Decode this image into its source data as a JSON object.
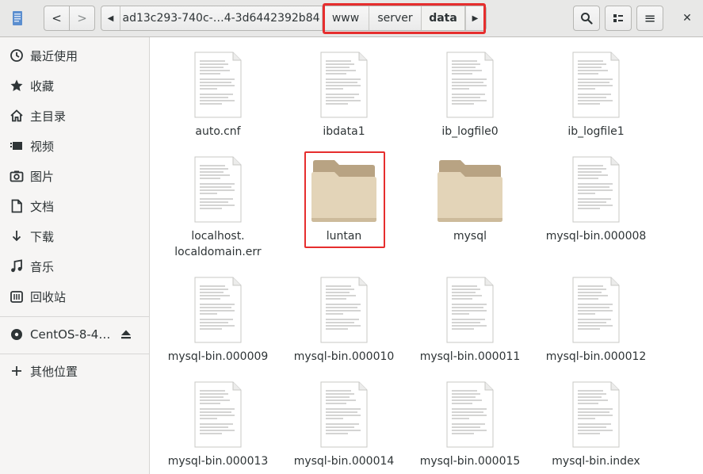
{
  "header": {
    "path_segments": [
      "ad13c293-740c-…4-3d6442392b84",
      "www",
      "server",
      "data"
    ],
    "back_glyph": "<",
    "forward_glyph": ">",
    "left_arrow_glyph": "◀",
    "right_arrow_glyph": "▶",
    "search_glyph": "🔍",
    "menu_glyph": "≡",
    "close_glyph": "✕"
  },
  "sidebar": {
    "items": [
      {
        "label": "最近使用",
        "icon": "clock-icon"
      },
      {
        "label": "收藏",
        "icon": "star-icon"
      },
      {
        "label": "主目录",
        "icon": "home-icon"
      },
      {
        "label": "视频",
        "icon": "video-icon"
      },
      {
        "label": "图片",
        "icon": "camera-icon"
      },
      {
        "label": "文档",
        "icon": "document-icon"
      },
      {
        "label": "下载",
        "icon": "download-icon"
      },
      {
        "label": "音乐",
        "icon": "music-icon"
      },
      {
        "label": "回收站",
        "icon": "trash-icon"
      }
    ],
    "device": {
      "label": "CentOS-8-4…",
      "icon": "disc-icon"
    },
    "other": {
      "label": "其他位置",
      "icon": "plus-icon"
    }
  },
  "files": [
    {
      "name": "auto.cnf",
      "type": "file"
    },
    {
      "name": "ibdata1",
      "type": "file"
    },
    {
      "name": "ib_logfile0",
      "type": "file"
    },
    {
      "name": "ib_logfile1",
      "type": "file"
    },
    {
      "name": "localhost.",
      "name2": "localdomain.err",
      "type": "file"
    },
    {
      "name": "luntan",
      "type": "folder"
    },
    {
      "name": "mysql",
      "type": "folder"
    },
    {
      "name": "mysql-bin.000008",
      "type": "file"
    },
    {
      "name": "mysql-bin.000009",
      "type": "file"
    },
    {
      "name": "mysql-bin.000010",
      "type": "file"
    },
    {
      "name": "mysql-bin.000011",
      "type": "file"
    },
    {
      "name": "mysql-bin.000012",
      "type": "file"
    },
    {
      "name": "mysql-bin.000013",
      "type": "file"
    },
    {
      "name": "mysql-bin.000014",
      "type": "file"
    },
    {
      "name": "mysql-bin.000015",
      "type": "file"
    },
    {
      "name": "mysql-bin.index",
      "type": "file"
    }
  ],
  "colors": {
    "highlight": "#e62e2e",
    "folder_back": "#b8a383",
    "folder_front": "#e3d4b8"
  }
}
